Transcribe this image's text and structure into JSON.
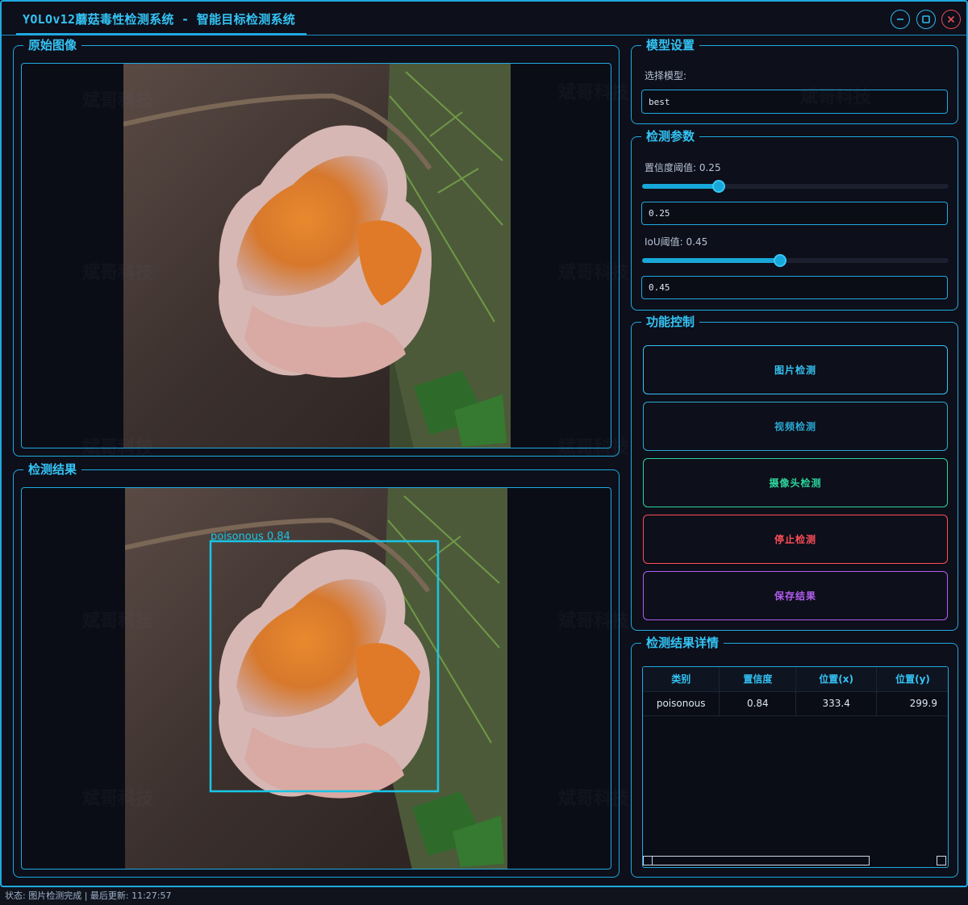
{
  "window": {
    "title": "YOLOv12蘑菇毒性检测系统 - 智能目标检测系统"
  },
  "panels": {
    "original": "原始图像",
    "result": "检测结果",
    "model": "模型设置",
    "params": "检测参数",
    "controls": "功能控制",
    "details": "检测结果详情"
  },
  "model": {
    "label": "选择模型:",
    "value": "best"
  },
  "params": {
    "conf_label": "置信度阈值: 0.25",
    "conf_value": "0.25",
    "conf_fraction": 0.25,
    "iou_label": "IoU阈值: 0.45",
    "iou_value": "0.45",
    "iou_fraction": 0.45
  },
  "buttons": {
    "image": "图片检测",
    "video": "视频检测",
    "camera": "摄像头检测",
    "stop": "停止检测",
    "save": "保存结果"
  },
  "button_colors": {
    "image": "#35c2f2",
    "video": "#2aa9d3",
    "camera": "#2dd39b",
    "stop": "#ff4d57",
    "save": "#b25cf0"
  },
  "detection": {
    "label": "poisonous 0.84",
    "box_color": "#19c6e6"
  },
  "table": {
    "headers": [
      "类别",
      "置信度",
      "位置(x)",
      "位置(y)"
    ],
    "rows": [
      [
        "poisonous",
        "0.84",
        "333.4",
        "299.9"
      ]
    ]
  },
  "status": "状态: 图片检测完成 | 最后更新: 11:27:57",
  "watermark": "斌哥科技"
}
